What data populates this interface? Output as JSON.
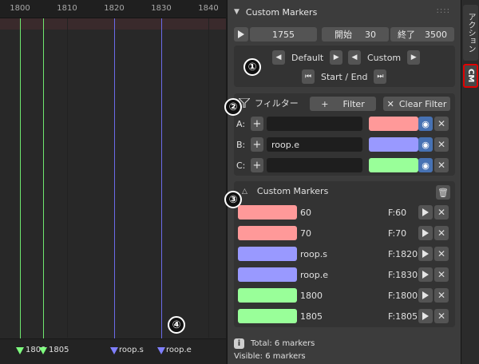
{
  "timeline": {
    "ticks": [
      "1800",
      "1810",
      "1820",
      "1830",
      "1840"
    ],
    "markers": [
      {
        "label": "1800",
        "color": "#7fff7f"
      },
      {
        "label": "1805",
        "color": "#7fff7f"
      },
      {
        "label": "roop.s",
        "color": "#8080ff"
      },
      {
        "label": "roop.e",
        "color": "#8080ff"
      }
    ],
    "annotation_4": "④"
  },
  "panel": {
    "title": "Custom Markers",
    "playback": {
      "current_frame": "1755",
      "start_label": "開始",
      "start_value": "30",
      "end_label": "終了",
      "end_value": "3500"
    },
    "annotation_1": "①",
    "nav": {
      "default_label": "Default",
      "custom_label": "Custom",
      "start_end_label": "Start / End"
    },
    "annotation_2": "②",
    "filter": {
      "title": "フィルター",
      "add_label": "Filter",
      "clear_label": "Clear Filter",
      "rows": [
        {
          "key": "A:",
          "value": "",
          "color": "#ff9999"
        },
        {
          "key": "B:",
          "value": "roop.e",
          "color": "#9999ff"
        },
        {
          "key": "C:",
          "value": "",
          "color": "#99ff99"
        }
      ]
    },
    "annotation_3": "③",
    "list": {
      "title": "Custom Markers",
      "items": [
        {
          "name": "60",
          "frame": "F:60",
          "color": "#ff9999"
        },
        {
          "name": "70",
          "frame": "F:70",
          "color": "#ff9999"
        },
        {
          "name": "roop.s",
          "frame": "F:1820",
          "color": "#9999ff"
        },
        {
          "name": "roop.e",
          "frame": "F:1830",
          "color": "#9999ff"
        },
        {
          "name": "1800",
          "frame": "F:1800",
          "color": "#99ff99"
        },
        {
          "name": "1805",
          "frame": "F:1805",
          "color": "#99ff99"
        }
      ]
    },
    "footer": {
      "total": "Total: 6 markers",
      "visible": "Visible: 6 markers"
    }
  },
  "sidebar": {
    "tabs": [
      {
        "label": "アクション"
      },
      {
        "label": "CM"
      }
    ]
  }
}
